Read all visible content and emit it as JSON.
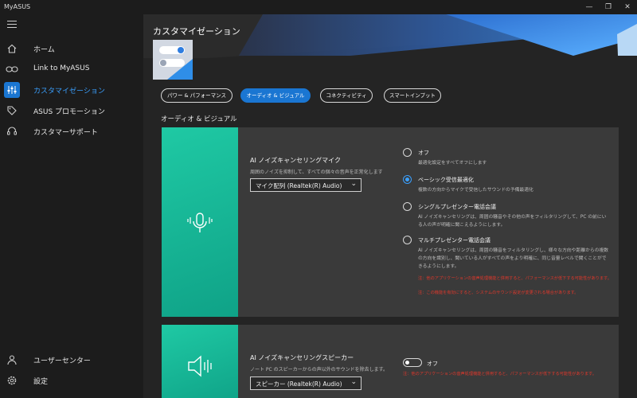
{
  "app": {
    "title": "MyASUS"
  },
  "window": {
    "minimize": "—",
    "maximize": "❐",
    "close": "✕"
  },
  "sidebar": {
    "items": [
      {
        "label": "ホーム",
        "icon": "home-icon"
      },
      {
        "label": "Link to MyASUS",
        "icon": "link-icon"
      },
      {
        "label": "カスタマイゼーション",
        "icon": "sliders-icon",
        "active": true
      },
      {
        "label": "ASUS プロモーション",
        "icon": "tag-icon"
      },
      {
        "label": "カスタマーサポート",
        "icon": "headset-icon"
      }
    ],
    "bottom": [
      {
        "label": "ユーザーセンター",
        "icon": "user-icon"
      },
      {
        "label": "設定",
        "icon": "gear-icon"
      }
    ]
  },
  "page": {
    "title": "カスタマイゼーション"
  },
  "tabs": [
    {
      "label": "パワー & パフォーマンス"
    },
    {
      "label": "オーディオ & ビジュアル",
      "active": true
    },
    {
      "label": "コネクティビティ"
    },
    {
      "label": "スマートインプット"
    }
  ],
  "section": {
    "title": "オーディオ & ビジュアル"
  },
  "mic_card": {
    "title": "AI ノイズキャンセリングマイク",
    "description": "周囲のノイズを抑制して、すべての個々の音声を正常化します",
    "device": "マイク配列 (Realtek(R) Audio)",
    "options": [
      {
        "label": "オフ",
        "desc": "最適化設定をすべてオフにします",
        "checked": false
      },
      {
        "label": "ベーシック受信最適化",
        "desc": "複数の方向からマイクで受信したサウンドの予備最適化",
        "checked": true
      },
      {
        "label": "シングルプレゼンター電話会議",
        "desc": "AI ノイズキャンセリングは、周囲の騒音やその他の声をフィルタリングして、PC の前にいる人の声が明確に聞こえるようにします。",
        "checked": false
      },
      {
        "label": "マルチプレゼンター電話会議",
        "desc": "AI ノイズキャンセリングは、周囲の騒音をフィルタリングし、様々な方向や距離からの複数の方向を識別し、聞いている人がすべての声をより明確に、同じ音量レベルで聞くことができるようにします。",
        "checked": false
      }
    ],
    "warnings": [
      "注：他のアプリケーションの音声処理機能と併用すると、パフォーマンスが低下する可能性があります。",
      "注：この機能を有効にすると、システムのサウンド設定が変更される場合があります。"
    ]
  },
  "speaker_card": {
    "title": "AI ノイズキャンセリングスピーカー",
    "description": "ノート PC のスピーカーからの声以外のサウンドを除去します。",
    "device": "スピーカー (Realtek(R) Audio)",
    "toggle_label": "オフ",
    "toggle_on": false,
    "warning": "注：他のアプリケーションの音声処理機能と併用すると、パフォーマンスが低下する可能性があります。"
  },
  "colors": {
    "accent": "#1a76d2",
    "teal": "#1fc9a4",
    "warning": "#e0382b"
  }
}
